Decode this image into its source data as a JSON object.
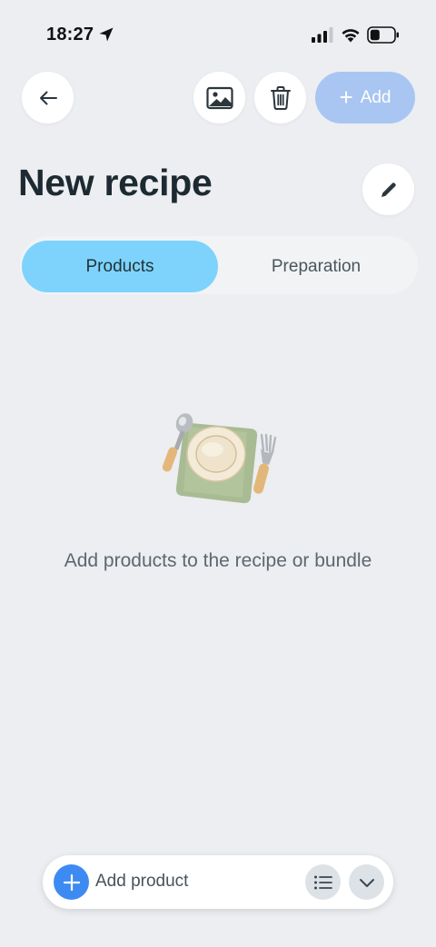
{
  "status_bar": {
    "time": "18:27"
  },
  "toolbar": {
    "add_label": "Add"
  },
  "page": {
    "title": "New recipe"
  },
  "tabs": [
    {
      "label": "Products",
      "active": true
    },
    {
      "label": "Preparation",
      "active": false
    }
  ],
  "empty_state": {
    "message": "Add products to the recipe or bundle",
    "illustration": "place-setting-icon"
  },
  "bottom_bar": {
    "add_product_label": "Add product"
  },
  "colors": {
    "background": "#eceef1",
    "active_tab": "#7dd3fc",
    "add_button": "#a9c6f2",
    "primary_blue": "#3d8bf2"
  }
}
